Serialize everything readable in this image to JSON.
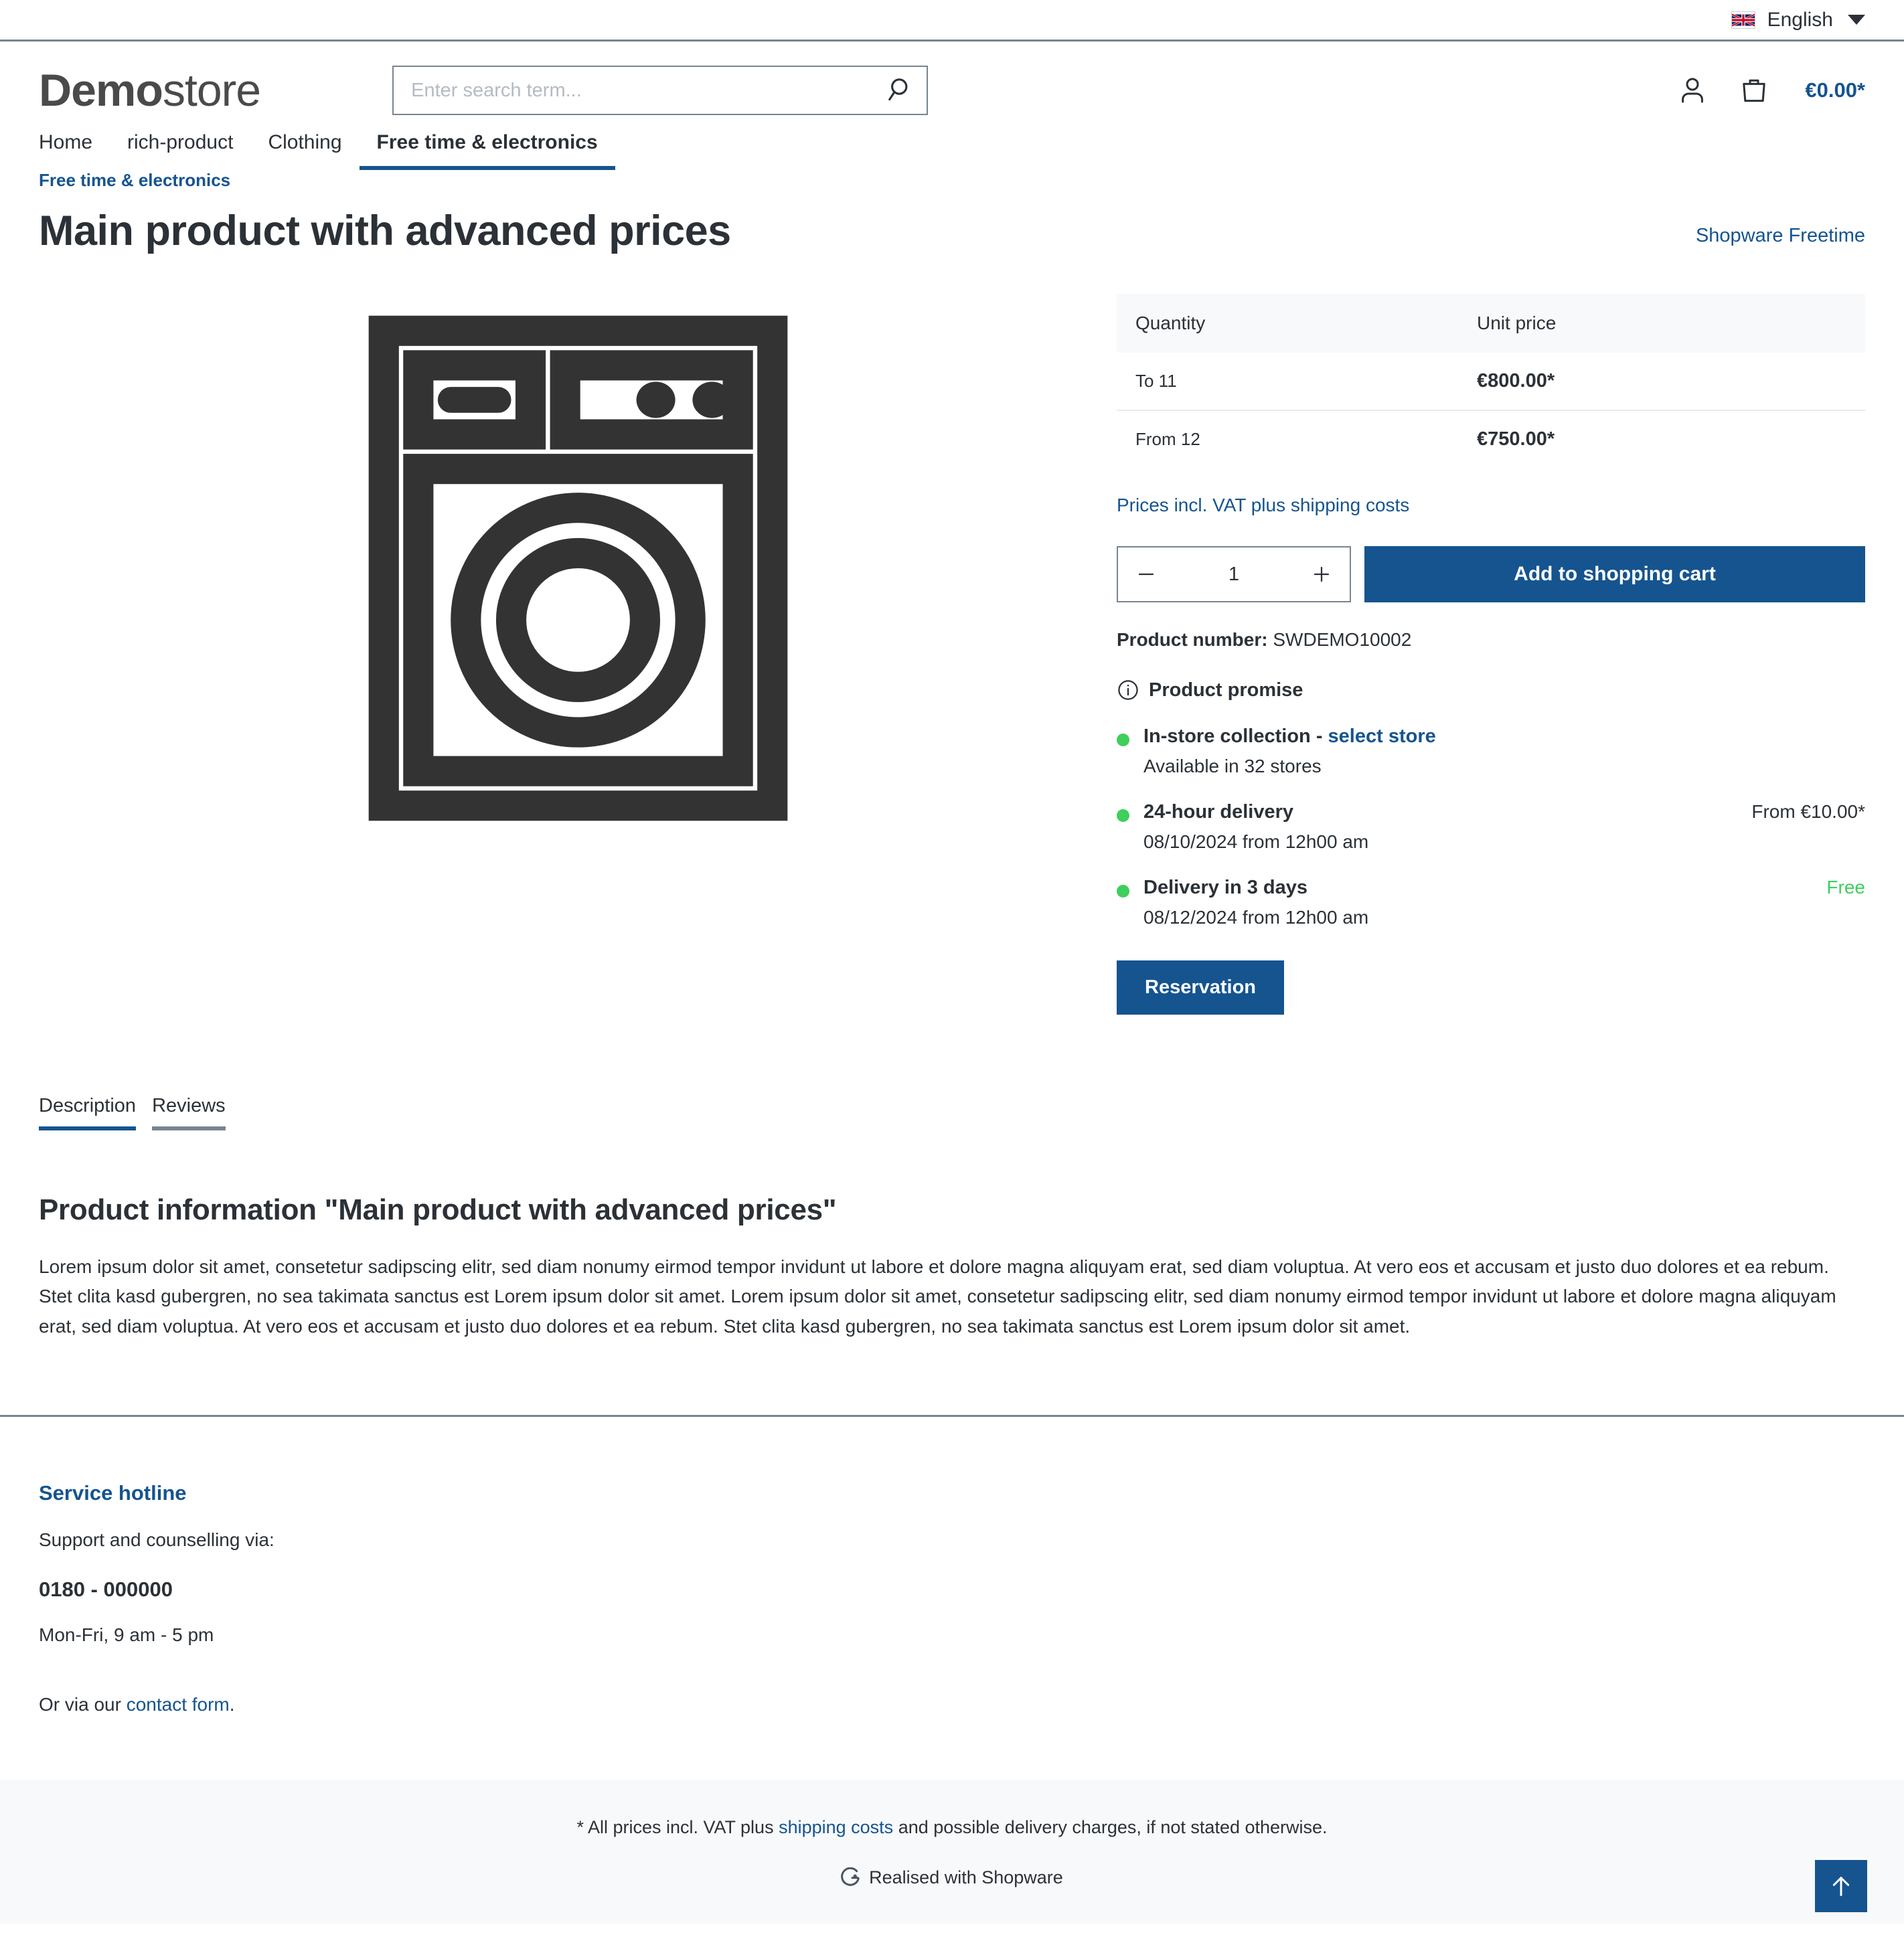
{
  "topbar": {
    "language": "English",
    "flag_icon": "uk-flag-icon",
    "caret_icon": "chevron-down-icon"
  },
  "header": {
    "logo_bold": "Demo",
    "logo_light": "store",
    "search": {
      "placeholder": "Enter search term...",
      "value": "",
      "icon": "search-icon"
    },
    "account_icon": "user-icon",
    "cart_icon": "shopping-bag-icon",
    "cart_total": "€0.00*"
  },
  "nav": {
    "items": [
      {
        "label": "Home",
        "active": false
      },
      {
        "label": "rich-product",
        "active": false
      },
      {
        "label": "Clothing",
        "active": false
      },
      {
        "label": "Free time & electronics",
        "active": true
      }
    ]
  },
  "product": {
    "breadcrumb": "Free time & electronics",
    "title": "Main product with advanced prices",
    "manufacturer": "Shopware Freetime",
    "image_icon": "washing-machine-icon",
    "price_table": {
      "headers": [
        "Quantity",
        "Unit price"
      ],
      "rows": [
        {
          "quantity": "To 11",
          "price": "€800.00*"
        },
        {
          "quantity": "From 12",
          "price": "€750.00*"
        }
      ]
    },
    "vat_note": "Prices incl. VAT plus shipping costs",
    "quantity": {
      "decrease_label": "−",
      "value": "1",
      "increase_label": "+",
      "minus_icon": "minus-icon",
      "plus_icon": "plus-icon"
    },
    "add_to_cart_label": "Add to shopping cart",
    "product_number_label": "Product number:",
    "product_number_value": "SWDEMO10002",
    "promise": {
      "icon": "info-circle-icon",
      "heading": "Product promise",
      "items": [
        {
          "title": "In-store collection - ",
          "link": "select store",
          "right": "",
          "right_free": false,
          "sub": "Available in 32 stores"
        },
        {
          "title": "24-hour delivery",
          "link": "",
          "right": "From €10.00*",
          "right_free": false,
          "sub": "08/10/2024 from 12h00 am"
        },
        {
          "title": "Delivery in 3 days",
          "link": "",
          "right": "Free",
          "right_free": true,
          "sub": "08/12/2024 from 12h00 am"
        }
      ]
    },
    "reservation_label": "Reservation"
  },
  "tabs": [
    {
      "label": "Description",
      "active": true
    },
    {
      "label": "Reviews",
      "active": false
    }
  ],
  "description": {
    "title": "Product information \"Main product with advanced prices\"",
    "body": "Lorem ipsum dolor sit amet, consetetur sadipscing elitr, sed diam nonumy eirmod tempor invidunt ut labore et dolore magna aliquyam erat, sed diam voluptua. At vero eos et accusam et justo duo dolores et ea rebum. Stet clita kasd gubergren, no sea takimata sanctus est Lorem ipsum dolor sit amet. Lorem ipsum dolor sit amet, consetetur sadipscing elitr, sed diam nonumy eirmod tempor invidunt ut labore et dolore magna aliquyam erat, sed diam voluptua. At vero eos et accusam et justo duo dolores et ea rebum. Stet clita kasd gubergren, no sea takimata sanctus est Lorem ipsum dolor sit amet."
  },
  "footer": {
    "hotline_heading": "Service hotline",
    "support_text": "Support and counselling via:",
    "phone": "0180 - 000000",
    "hours": "Mon-Fri, 9 am - 5 pm",
    "contact_prefix": "Or via our ",
    "contact_link": "contact form",
    "contact_suffix": ".",
    "vat_prefix": "* All prices incl. VAT plus ",
    "vat_link": "shipping costs",
    "vat_suffix": " and possible delivery charges, if not stated otherwise.",
    "brand_icon": "shopware-logo-icon",
    "brand_text": "Realised with Shopware",
    "scroll_top_icon": "arrow-up-icon"
  },
  "colors": {
    "brand_blue": "#15548f",
    "green": "#3ecf5c",
    "border_gray": "#798490",
    "text": "#2b3137",
    "header_bg": "#f8f9fa"
  }
}
